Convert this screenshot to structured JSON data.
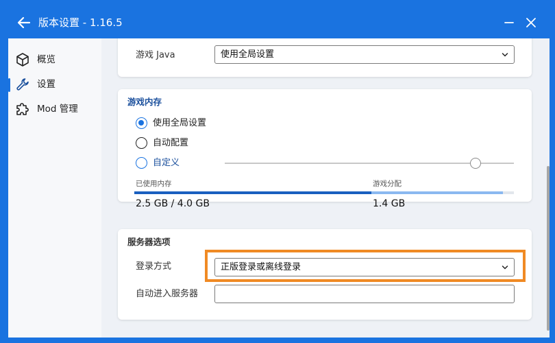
{
  "window": {
    "title": "版本设置 - 1.16.5",
    "accent": "#1a73e0"
  },
  "sidebar": {
    "items": [
      {
        "label": "概览",
        "icon": "cube-icon",
        "active": false
      },
      {
        "label": "设置",
        "icon": "wrench-icon",
        "active": true
      },
      {
        "label": "Mod 管理",
        "icon": "puzzle-icon",
        "active": false
      }
    ]
  },
  "java": {
    "label": "游戏 Java",
    "value": "使用全局设置"
  },
  "memory": {
    "title": "游戏内存",
    "options": [
      {
        "label": "使用全局设置",
        "selected": true
      },
      {
        "label": "自动配置",
        "selected": false
      },
      {
        "label": "自定义",
        "selected": false
      }
    ],
    "used_label": "已使用内存",
    "used_value": "2.5 GB / 4.0 GB",
    "game_label": "游戏分配",
    "game_value": "1.4 GB"
  },
  "server": {
    "title": "服务器选项",
    "login_label": "登录方式",
    "login_value": "正版登录或离线登录",
    "auto_join_label": "自动进入服务器",
    "auto_join_value": ""
  },
  "colors": {
    "highlight": "#f08a24"
  }
}
